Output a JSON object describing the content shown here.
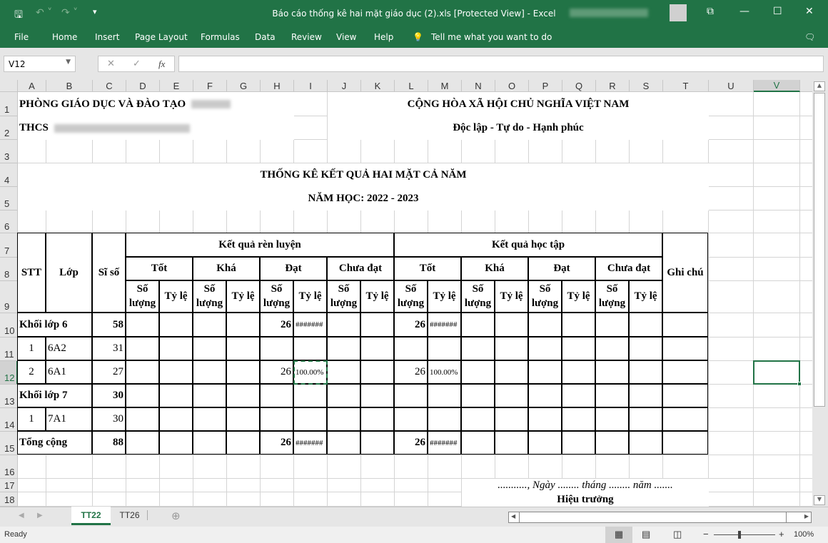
{
  "window": {
    "title": "Báo cáo thống kê hai mặt giáo dục (2).xls  [Protected View]  -  Excel"
  },
  "ribbon": {
    "tabs": [
      "File",
      "Home",
      "Insert",
      "Page Layout",
      "Formulas",
      "Data",
      "Review",
      "View",
      "Help"
    ],
    "tell_me": "Tell me what you want to do"
  },
  "formula_bar": {
    "name_box": "V12",
    "fx": "fx",
    "value": ""
  },
  "sheet": {
    "columns": [
      "A",
      "B",
      "C",
      "D",
      "E",
      "F",
      "G",
      "H",
      "I",
      "J",
      "K",
      "L",
      "M",
      "N",
      "O",
      "P",
      "Q",
      "R",
      "S",
      "T",
      "U",
      "V"
    ],
    "rows": [
      "1",
      "2",
      "3",
      "4",
      "5",
      "6",
      "7",
      "8",
      "9",
      "10",
      "11",
      "12",
      "13",
      "14",
      "15",
      "16",
      "17",
      "18"
    ],
    "selected_cell": "V12"
  },
  "report": {
    "org": "PHÒNG GIÁO DỤC VÀ ĐÀO TẠO",
    "school": "THCS",
    "nation": "CỘNG HÒA XÃ HỘI CHỦ NGHĨA VIỆT NAM",
    "motto": "Độc lập - Tự do - Hạnh phúc",
    "title": "THỐNG KÊ KẾT QUẢ HAI MẶT CẢ NĂM",
    "year": "NĂM HỌC: 2022 - 2023",
    "headers": {
      "stt": "STT",
      "lop": "Lớp",
      "siso": "Sĩ số",
      "ghichu": "Ghi chú",
      "conduct": "Kết quả rèn luyện",
      "study": "Kết quả học tập",
      "levels": [
        "Tốt",
        "Khá",
        "Đạt",
        "Chưa đạt",
        "Tốt",
        "Khá",
        "Đạt",
        "Chưa đạt"
      ],
      "so_luong": "Số lượng",
      "ty_le": "Tỷ lệ"
    },
    "rows": [
      {
        "group": true,
        "stt": "",
        "lop": "Khối lớp 6",
        "siso": "58",
        "vals": [
          "",
          "",
          "",
          "",
          "26",
          "#######",
          "",
          "",
          "26",
          "#######",
          "",
          "",
          "",
          "",
          "",
          ""
        ]
      },
      {
        "group": false,
        "stt": "1",
        "lop": "6A2",
        "siso": "31",
        "vals": [
          "",
          "",
          "",
          "",
          "",
          "",
          "",
          "",
          "",
          "",
          "",
          "",
          "",
          "",
          "",
          ""
        ]
      },
      {
        "group": false,
        "stt": "2",
        "lop": "6A1",
        "siso": "27",
        "vals": [
          "",
          "",
          "",
          "",
          "26",
          "100.00%",
          "",
          "",
          "26",
          "100.00%",
          "",
          "",
          "",
          "",
          "",
          ""
        ]
      },
      {
        "group": true,
        "stt": "",
        "lop": "Khối lớp 7",
        "siso": "30",
        "vals": [
          "",
          "",
          "",
          "",
          "",
          "",
          "",
          "",
          "",
          "",
          "",
          "",
          "",
          "",
          "",
          ""
        ]
      },
      {
        "group": false,
        "stt": "1",
        "lop": "7A1",
        "siso": "30",
        "vals": [
          "",
          "",
          "",
          "",
          "",
          "",
          "",
          "",
          "",
          "",
          "",
          "",
          "",
          "",
          "",
          ""
        ]
      },
      {
        "group": true,
        "stt": "",
        "lop": "Tổng cộng",
        "siso": "88",
        "vals": [
          "",
          "",
          "",
          "",
          "26",
          "#######",
          "",
          "",
          "26",
          "#######",
          "",
          "",
          "",
          "",
          "",
          ""
        ]
      }
    ],
    "date_line": "..........., Ngày ........ tháng ........ năm .......",
    "signer": "Hiệu trưởng"
  },
  "sheet_tabs": [
    "TT22",
    "TT26"
  ],
  "active_sheet": "TT22",
  "status": {
    "ready": "Ready",
    "zoom": "100%"
  },
  "colors": {
    "accent": "#217346"
  }
}
